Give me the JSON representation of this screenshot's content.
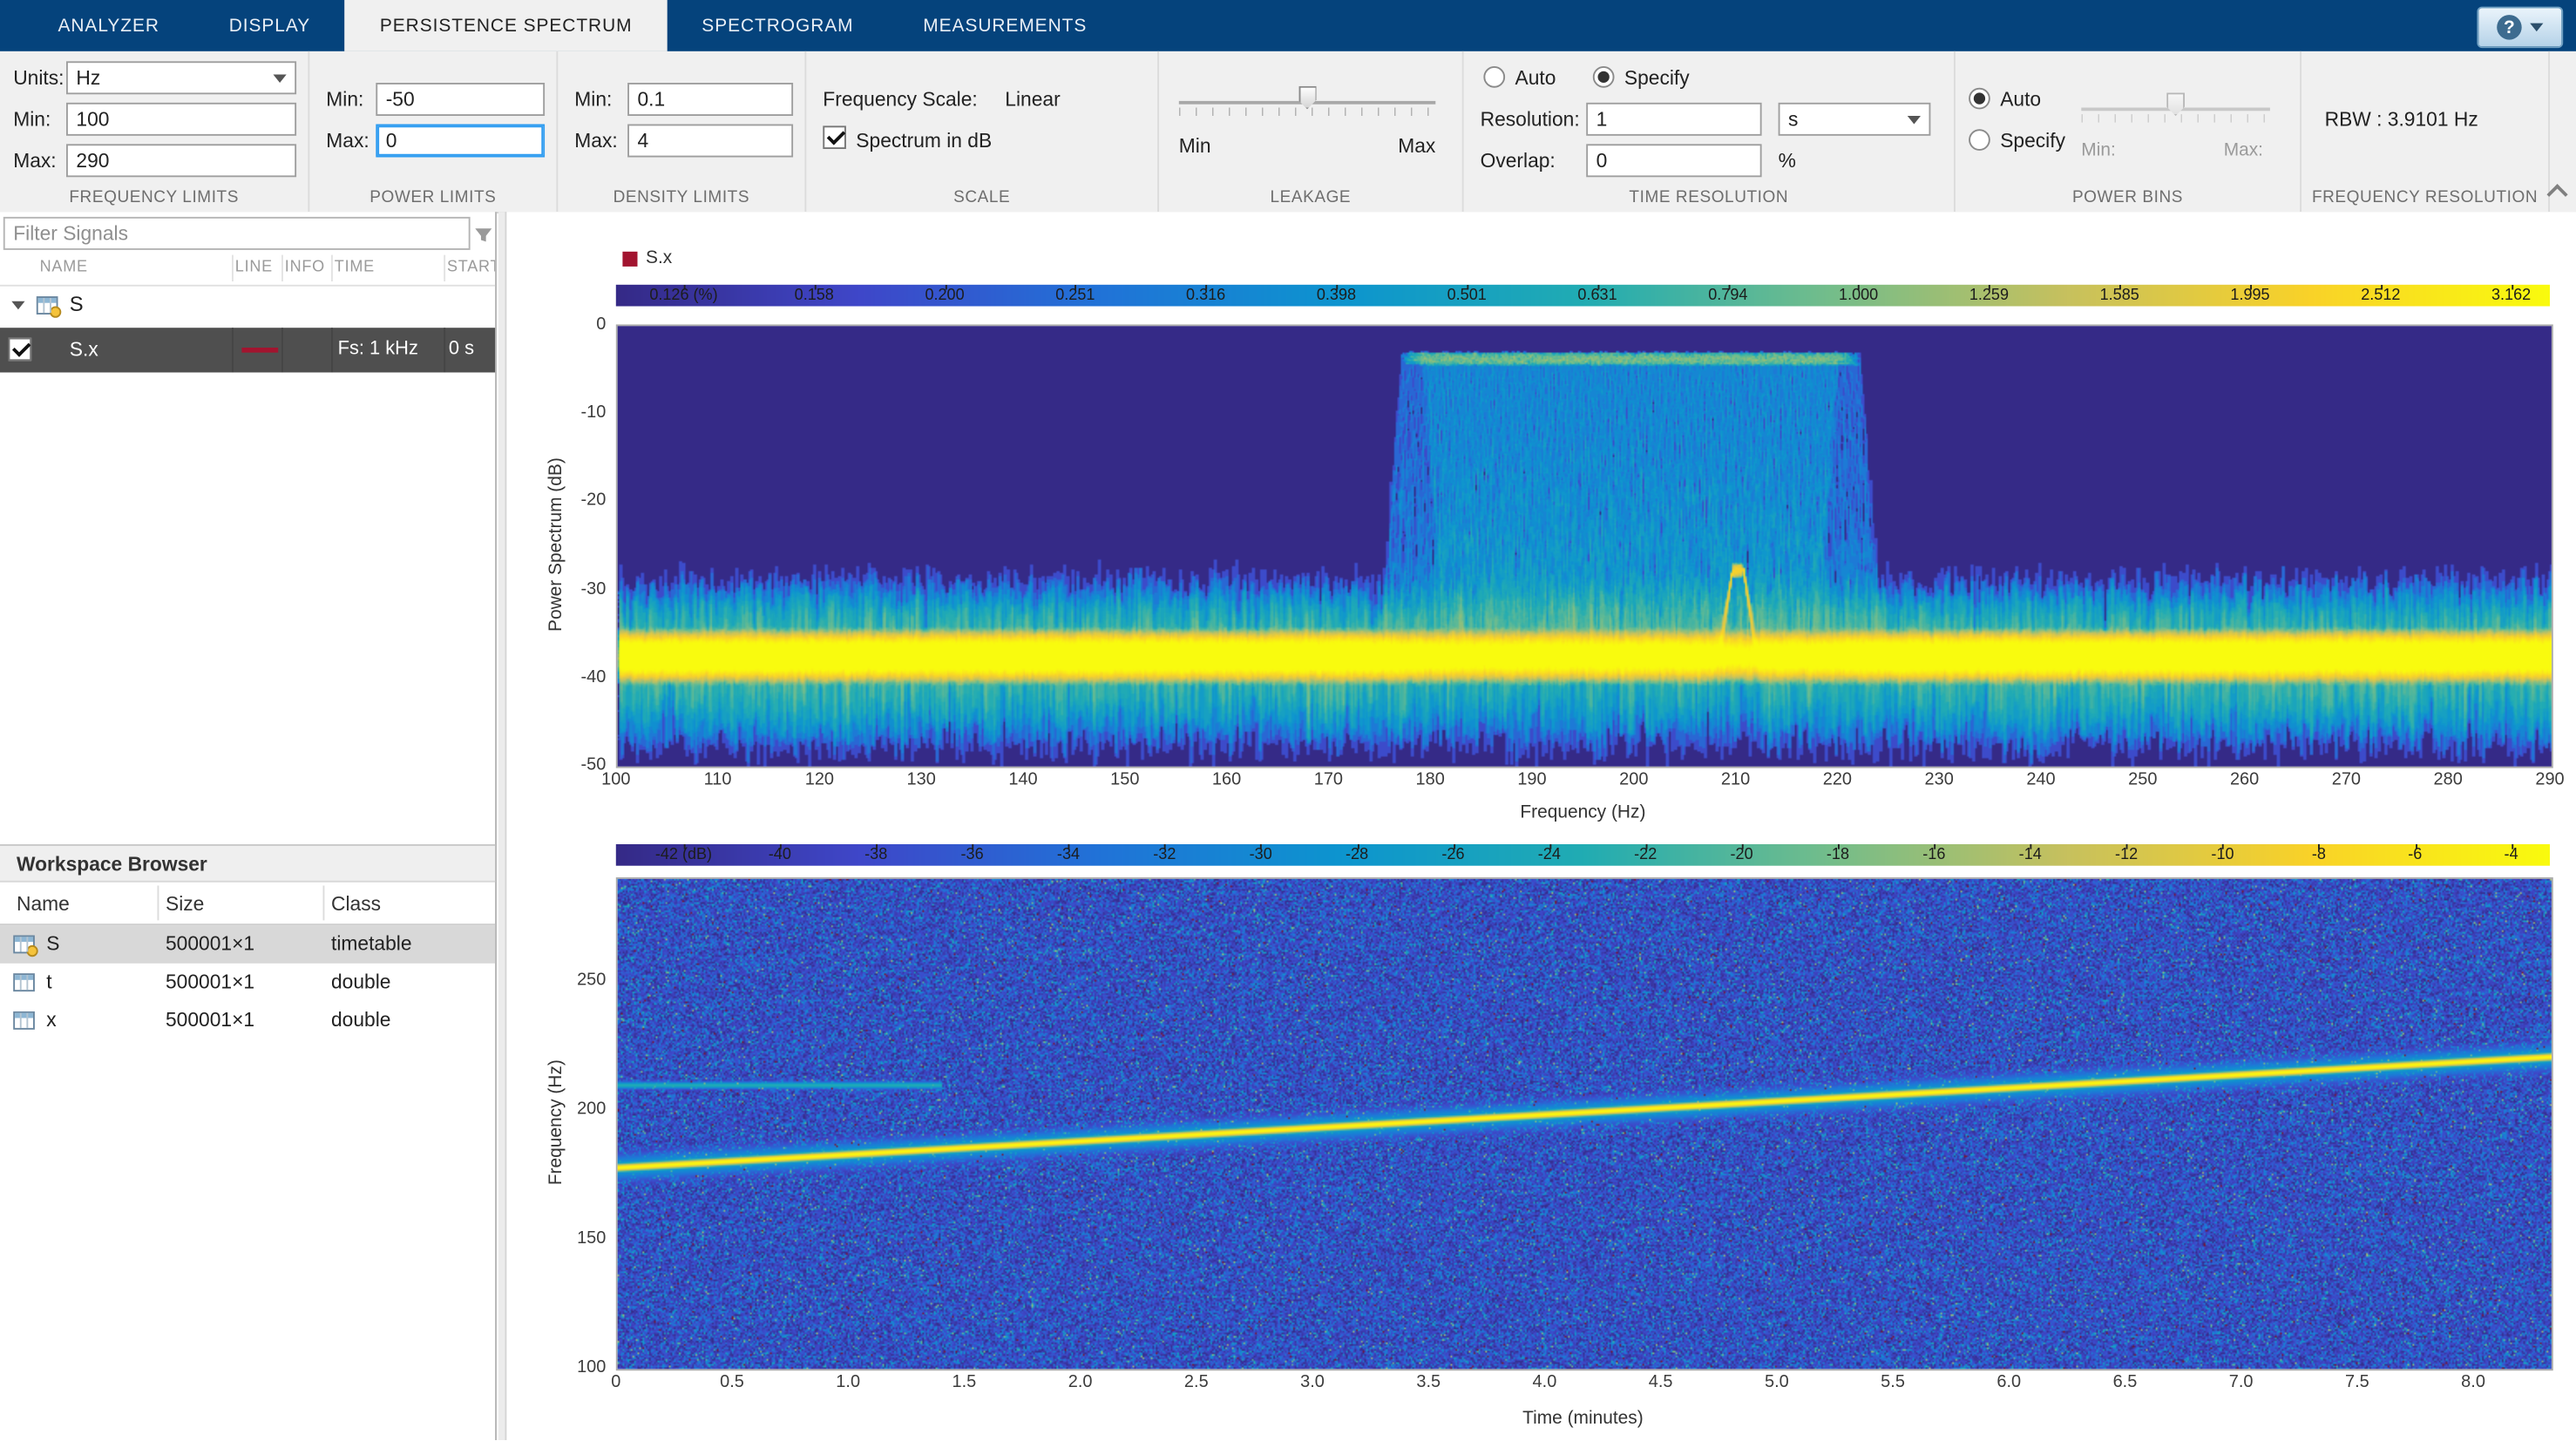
{
  "tab_bar": {
    "tabs": [
      "ANALYZER",
      "DISPLAY",
      "PERSISTENCE SPECTRUM",
      "SPECTROGRAM",
      "MEASUREMENTS"
    ],
    "active_tab": "PERSISTENCE SPECTRUM",
    "help_label": "?"
  },
  "ribbon": {
    "frequency_limits": {
      "title": "FREQUENCY LIMITS",
      "units_label": "Units:",
      "units_value": "Hz",
      "min_label": "Min:",
      "min_value": "100",
      "max_label": "Max:",
      "max_value": "290"
    },
    "power_limits": {
      "title": "POWER LIMITS",
      "min_label": "Min:",
      "min_value": "-50",
      "max_label": "Max:",
      "max_value": "0"
    },
    "density_limits": {
      "title": "DENSITY LIMITS",
      "min_label": "Min:",
      "min_value": "0.1",
      "max_label": "Max:",
      "max_value": "4"
    },
    "scale": {
      "title": "SCALE",
      "freq_scale_label": "Frequency Scale:",
      "freq_scale_value": "Linear",
      "spectrum_db_label": "Spectrum in dB",
      "spectrum_db_checked": true
    },
    "leakage": {
      "title": "LEAKAGE",
      "min_label": "Min",
      "max_label": "Max",
      "value_fraction": 0.5
    },
    "time_resolution": {
      "title": "TIME RESOLUTION",
      "auto_label": "Auto",
      "specify_label": "Specify",
      "selected": "Specify",
      "resolution_label": "Resolution:",
      "resolution_value": "1",
      "resolution_units": "s",
      "overlap_label": "Overlap:",
      "overlap_value": "0",
      "overlap_units": "%"
    },
    "power_bins": {
      "title": "POWER BINS",
      "auto_label": "Auto",
      "specify_label": "Specify",
      "selected": "Auto",
      "min_label": "Min:",
      "max_label": "Max:",
      "value_fraction": 0.5
    },
    "frequency_resolution": {
      "title": "FREQUENCY RESOLUTION",
      "rbw_text": "RBW : 3.9101 Hz"
    }
  },
  "signal_panel": {
    "filter_placeholder": "Filter Signals",
    "columns": [
      "NAME",
      "LINE",
      "INFO",
      "TIME",
      "START"
    ],
    "group_name": "S",
    "signal": {
      "name": "S.x",
      "checked": true,
      "line_color": "#a2142f",
      "time": "Fs: 1 kHz",
      "start": "0 s"
    }
  },
  "workspace": {
    "title": "Workspace Browser",
    "columns": [
      "Name",
      "Size",
      "Class"
    ],
    "rows": [
      {
        "name": "S",
        "size": "500001×1",
        "class": "timetable",
        "selected": true
      },
      {
        "name": "t",
        "size": "500001×1",
        "class": "double",
        "selected": false
      },
      {
        "name": "x",
        "size": "500001×1",
        "class": "double",
        "selected": false
      }
    ]
  },
  "chart_data": [
    {
      "type": "heatmap",
      "name": "persistence-spectrum",
      "legend": "S.x",
      "legend_color": "#a2142f",
      "xlabel": "Frequency (Hz)",
      "ylabel": "Power Spectrum (dB)",
      "xlim": [
        100,
        290
      ],
      "ylim": [
        -50,
        0
      ],
      "xtick_values": [
        100,
        110,
        120,
        130,
        140,
        150,
        160,
        170,
        180,
        190,
        200,
        210,
        220,
        230,
        240,
        250,
        260,
        270,
        280,
        290
      ],
      "xtick_labels": [
        "100",
        "110",
        "120",
        "130",
        "140",
        "150",
        "160",
        "170",
        "180",
        "190",
        "200",
        "210",
        "220",
        "230",
        "240",
        "250",
        "260",
        "270",
        "280",
        "290"
      ],
      "ytick_values": [
        0,
        -10,
        -20,
        -30,
        -40,
        -50
      ],
      "ytick_labels": [
        "0",
        "-10",
        "-20",
        "-30",
        "-40",
        "-50"
      ],
      "colormap": "parula",
      "colorbar_labels": [
        "0.126 (%)",
        "0.158",
        "0.200",
        "0.251",
        "0.316",
        "0.398",
        "0.501",
        "0.631",
        "0.794",
        "1.000",
        "1.259",
        "1.585",
        "1.995",
        "2.512",
        "3.162"
      ],
      "features": {
        "noise": {
          "floor_db": -37.5,
          "spread_db": 3.4
        },
        "band": {
          "f_start_hz": 178,
          "f_end_hz": 221,
          "top_db": -3
        },
        "tone": {
          "freq_hz": 210,
          "peak_db": -27,
          "duration_fraction": 0.17
        }
      }
    },
    {
      "type": "heatmap",
      "name": "spectrogram",
      "xlabel": "Time (minutes)",
      "ylabel": "Frequency (Hz)",
      "xlim": [
        0,
        8.33
      ],
      "ylim": [
        100,
        290
      ],
      "xtick_values": [
        0,
        0.5,
        1,
        1.5,
        2,
        2.5,
        3,
        3.5,
        4,
        4.5,
        5,
        5.5,
        6,
        6.5,
        7,
        7.5,
        8
      ],
      "xtick_labels": [
        "0",
        "0.5",
        "1.0",
        "1.5",
        "2.0",
        "2.5",
        "3.0",
        "3.5",
        "4.0",
        "4.5",
        "5.0",
        "5.5",
        "6.0",
        "6.5",
        "7.0",
        "7.5",
        "8.0"
      ],
      "ytick_values": [
        250,
        200,
        150,
        100
      ],
      "ytick_labels": [
        "250",
        "200",
        "150",
        "100"
      ],
      "colormap": "parula",
      "colorbar_labels": [
        "-42 (dB)",
        "-40",
        "-38",
        "-36",
        "-34",
        "-32",
        "-30",
        "-28",
        "-26",
        "-24",
        "-22",
        "-20",
        "-18",
        "-16",
        "-14",
        "-12",
        "-10",
        "-8",
        "-6",
        "-4"
      ],
      "features": {
        "chirp": {
          "f_start_hz": 178,
          "f_end_hz": 221,
          "t_start_min": 0,
          "t_end_min": 8.33
        },
        "tone": {
          "freq_hz": 210,
          "t_start_min": 0,
          "t_end_min": 1.4
        }
      }
    }
  ]
}
